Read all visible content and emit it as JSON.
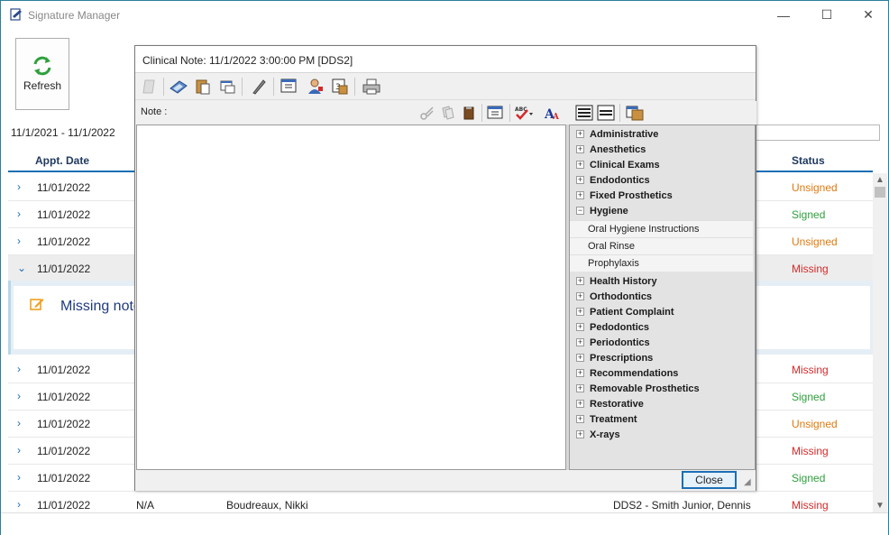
{
  "window": {
    "title": "Signature Manager",
    "min_glyph": "—",
    "max_glyph": "☐",
    "close_glyph": "✕"
  },
  "toolbar": {
    "refresh_label": "Refresh"
  },
  "date_range": "11/1/2021 - 11/1/2022",
  "grid": {
    "headers": {
      "appt_date": "Appt. Date",
      "status": "Status"
    },
    "rows": [
      {
        "date": "11/01/2022",
        "status": "Unsigned",
        "chev": "›"
      },
      {
        "date": "11/01/2022",
        "status": "Signed",
        "chev": "›"
      },
      {
        "date": "11/01/2022",
        "status": "Unsigned",
        "chev": "›"
      },
      {
        "date": "11/01/2022",
        "status": "Missing",
        "chev": "⌄"
      },
      {
        "date": "11/01/2022",
        "status": "Missing",
        "chev": "›"
      },
      {
        "date": "11/01/2022",
        "status": "Signed",
        "chev": "›"
      },
      {
        "date": "11/01/2022",
        "status": "Unsigned",
        "chev": "›"
      },
      {
        "date": "11/01/2022",
        "status": "Missing",
        "chev": "›"
      },
      {
        "date": "11/01/2022",
        "status": "Signed",
        "chev": "›"
      },
      {
        "date": "11/01/2022",
        "status": "Missing",
        "chev": "›",
        "type": "N/A",
        "patient": "Boudreaux, Nikki",
        "provider": "DDS2 - Smith Junior, Dennis"
      }
    ],
    "detail_text": "Missing note"
  },
  "colors": {
    "unsigned": "#e07a10",
    "signed": "#2ea03c",
    "missing": "#d42a2a",
    "accent": "#1a6fb5"
  },
  "dialog": {
    "title": "Clinical Note: 11/1/2022 3:00:00 PM [DDS2]",
    "note_label": "Note :",
    "close_label": "Close",
    "tree": {
      "categories_before": [
        "Administrative",
        "Anesthetics",
        "Clinical Exams",
        "Endodontics",
        "Fixed Prosthetics"
      ],
      "expanded": "Hygiene",
      "children": [
        "Oral Hygiene Instructions",
        "Oral Rinse",
        "Prophylaxis"
      ],
      "categories_after": [
        "Health History",
        "Orthodontics",
        "Patient Complaint",
        "Pedodontics",
        "Periodontics",
        "Prescriptions",
        "Recommendations",
        "Removable Prosthetics",
        "Restorative",
        "Treatment",
        "X-rays"
      ]
    }
  }
}
